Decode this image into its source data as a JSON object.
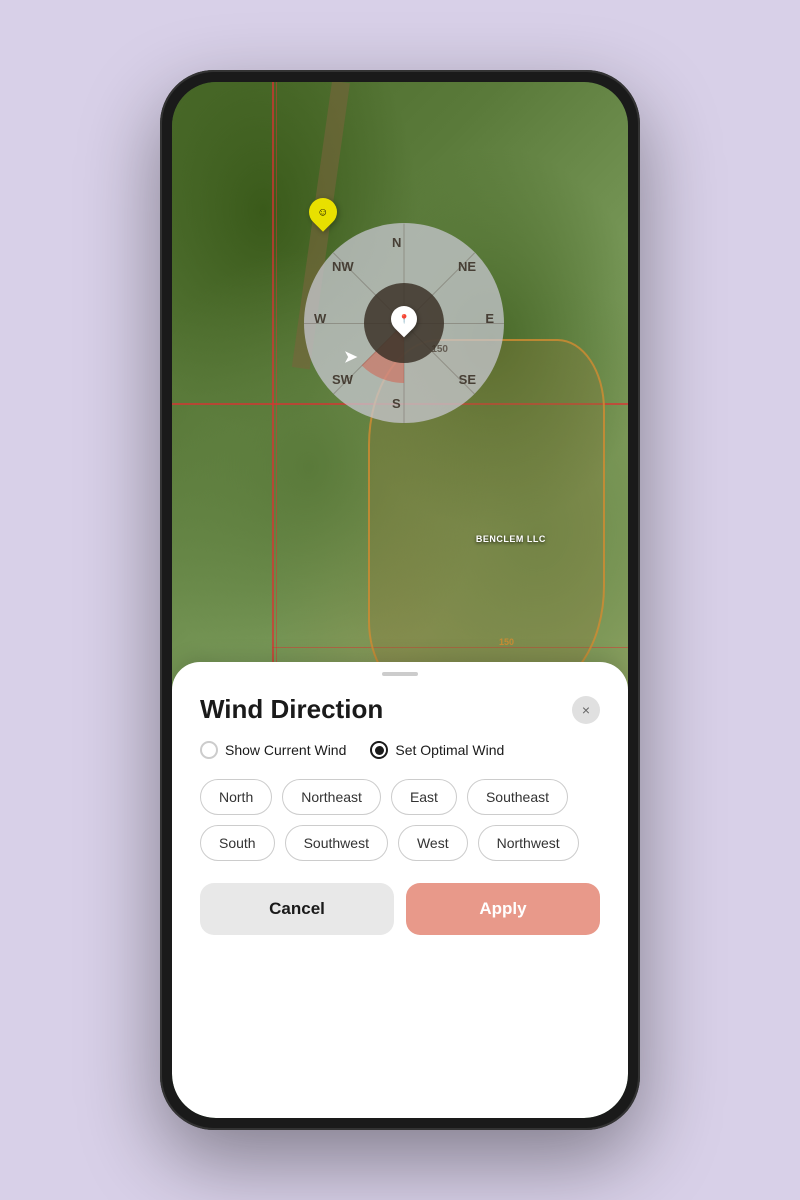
{
  "phone": {
    "map": {
      "fieldLabel": "BENCLEM\nLLC",
      "label150": "150",
      "label150Bottom": "150"
    },
    "compass": {
      "directions": {
        "N": "N",
        "NE": "NE",
        "E": "E",
        "SE": "SE",
        "S": "S",
        "SW": "SW",
        "W": "W",
        "NW": "NW"
      },
      "radiusLabel": "150"
    },
    "sheet": {
      "title": "Wind Direction",
      "closeIcon": "×",
      "radioOptions": [
        {
          "id": "show-current",
          "label": "Show Current Wind",
          "selected": false
        },
        {
          "id": "set-optimal",
          "label": "Set Optimal Wind",
          "selected": true
        }
      ],
      "directionChips": [
        "North",
        "Northeast",
        "East",
        "Southeast",
        "South",
        "Southwest",
        "West",
        "Northwest"
      ],
      "cancelLabel": "Cancel",
      "applyLabel": "Apply"
    }
  }
}
